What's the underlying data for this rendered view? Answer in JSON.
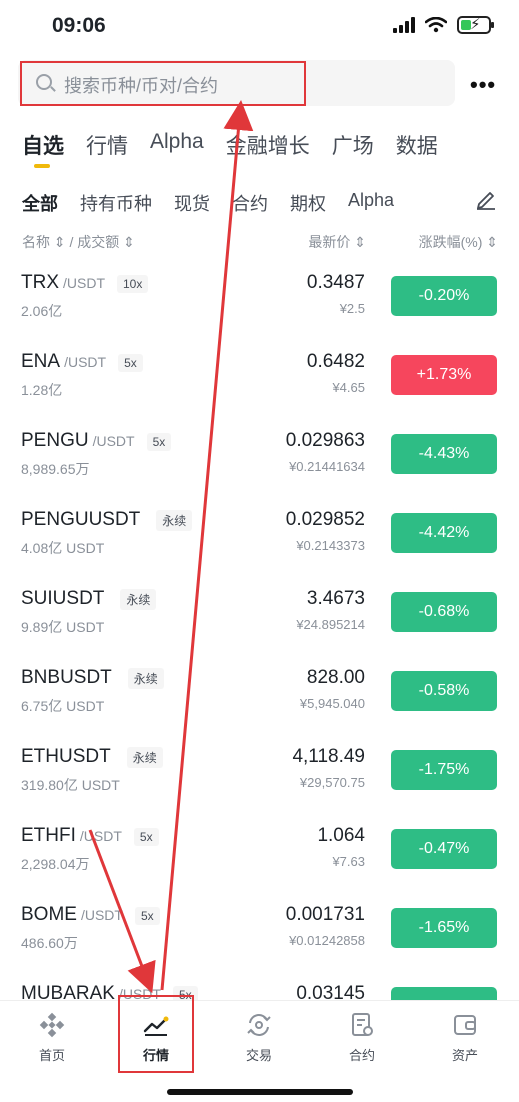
{
  "status": {
    "time": "09:06"
  },
  "search": {
    "placeholder": "搜索币种/币对/合约"
  },
  "main_tabs": [
    {
      "label": "自选",
      "active": true
    },
    {
      "label": "行情"
    },
    {
      "label": "Alpha"
    },
    {
      "label": "金融增长"
    },
    {
      "label": "广场"
    },
    {
      "label": "数据"
    }
  ],
  "sub_tabs": [
    {
      "label": "全部",
      "active": true
    },
    {
      "label": "持有币种"
    },
    {
      "label": "现货"
    },
    {
      "label": "合约"
    },
    {
      "label": "期权"
    },
    {
      "label": "Alpha"
    }
  ],
  "columns": {
    "name": "名称 ⇕ / 成交额 ⇕",
    "price": "最新价 ⇕",
    "change": "涨跌幅(%) ⇕"
  },
  "rows": [
    {
      "base": "TRX",
      "quote": "/USDT",
      "badge": "10x",
      "volume": "2.06亿",
      "price": "0.3487",
      "cny": "¥2.5",
      "change": "-0.20%",
      "dir": "down"
    },
    {
      "base": "ENA",
      "quote": "/USDT",
      "badge": "5x",
      "volume": "1.28亿",
      "price": "0.6482",
      "cny": "¥4.65",
      "change": "+1.73%",
      "dir": "up"
    },
    {
      "base": "PENGU",
      "quote": "/USDT",
      "badge": "5x",
      "volume": "8,989.65万",
      "price": "0.029863",
      "cny": "¥0.21441634",
      "change": "-4.43%",
      "dir": "down"
    },
    {
      "base": "PENGUUSDT",
      "quote": "",
      "badge": "永续",
      "volume": "4.08亿 USDT",
      "price": "0.029852",
      "cny": "¥0.2143373",
      "change": "-4.42%",
      "dir": "down"
    },
    {
      "base": "SUIUSDT",
      "quote": "",
      "badge": "永续",
      "volume": "9.89亿 USDT",
      "price": "3.4673",
      "cny": "¥24.895214",
      "change": "-0.68%",
      "dir": "down"
    },
    {
      "base": "BNBUSDT",
      "quote": "",
      "badge": "永续",
      "volume": "6.75亿 USDT",
      "price": "828.00",
      "cny": "¥5,945.040",
      "change": "-0.58%",
      "dir": "down"
    },
    {
      "base": "ETHUSDT",
      "quote": "",
      "badge": "永续",
      "volume": "319.80亿 USDT",
      "price": "4,118.49",
      "cny": "¥29,570.75",
      "change": "-1.75%",
      "dir": "down"
    },
    {
      "base": "ETHFI",
      "quote": "/USDT",
      "badge": "5x",
      "volume": "2,298.04万",
      "price": "1.064",
      "cny": "¥7.63",
      "change": "-0.47%",
      "dir": "down"
    },
    {
      "base": "BOME",
      "quote": "/USDT",
      "badge": "5x",
      "volume": "486.60万",
      "price": "0.001731",
      "cny": "¥0.01242858",
      "change": "-1.65%",
      "dir": "down"
    },
    {
      "base": "MUBARAK",
      "quote": "/USDT",
      "badge": "5x",
      "volume": "",
      "price": "0.03145",
      "cny": "",
      "change": "",
      "dir": "down"
    }
  ],
  "tab_bar": [
    {
      "label": "首页",
      "icon": "binance-logo-icon"
    },
    {
      "label": "行情",
      "icon": "market-trend-icon",
      "active": true
    },
    {
      "label": "交易",
      "icon": "trade-swap-icon"
    },
    {
      "label": "合约",
      "icon": "futures-doc-icon"
    },
    {
      "label": "资产",
      "icon": "wallet-icon"
    }
  ],
  "colors": {
    "accent": "#f0b90b",
    "up": "#f6465d",
    "down": "#2ebd85",
    "annotation": "#e0373a"
  }
}
